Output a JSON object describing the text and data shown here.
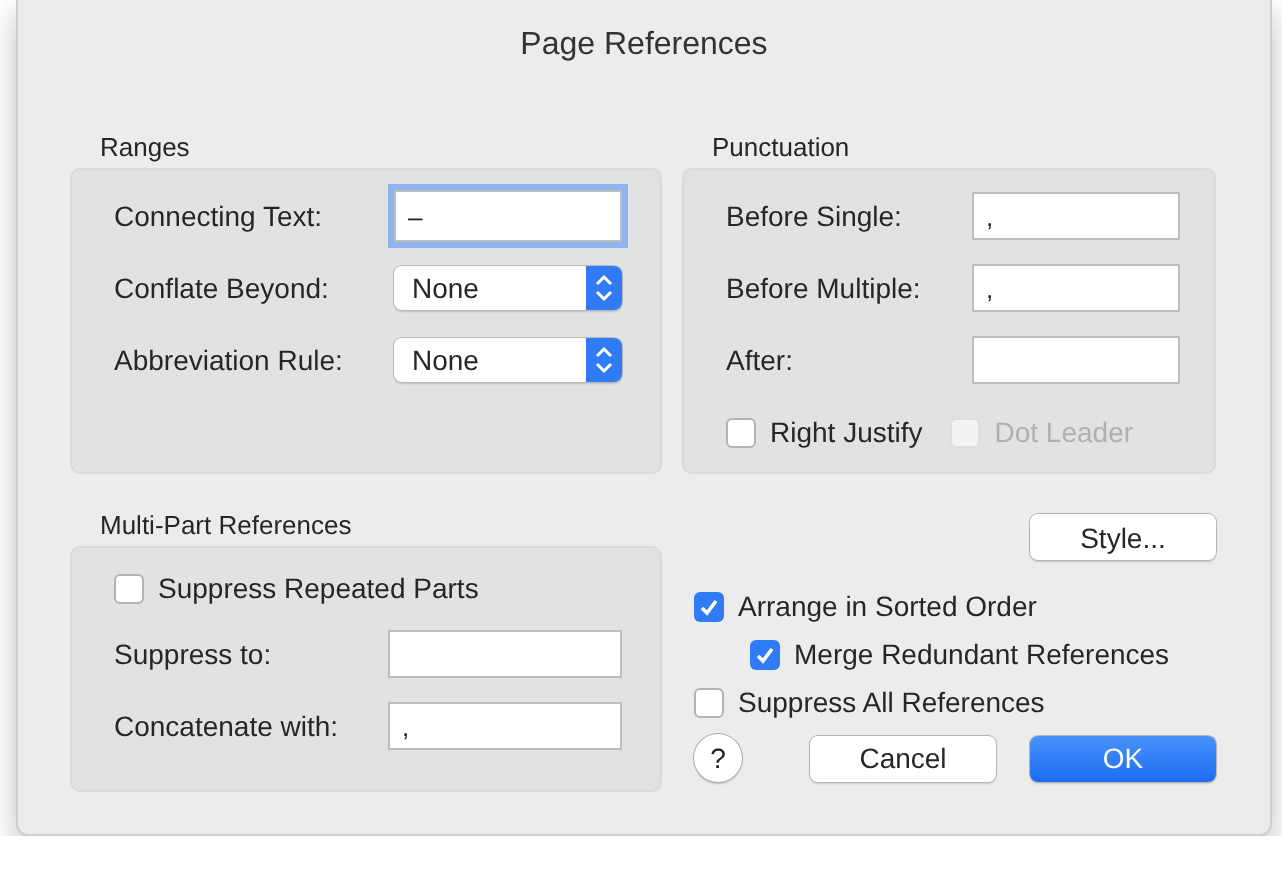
{
  "window": {
    "title": "Page References"
  },
  "ranges": {
    "title": "Ranges",
    "rows": [
      {
        "kind": "field",
        "label": "Connecting Text:",
        "value": "–",
        "focused": true
      },
      {
        "kind": "popup",
        "label": "Conflate Beyond:",
        "value": "None"
      },
      {
        "kind": "popup",
        "label": "Abbreviation Rule:",
        "value": "None"
      }
    ]
  },
  "punctuation": {
    "title": "Punctuation",
    "rows": [
      {
        "label": "Before Single:",
        "value": ","
      },
      {
        "label": "Before Multiple:",
        "value": ","
      },
      {
        "label": "After:"
      }
    ],
    "checkboxes": [
      {
        "label": "Right Justify",
        "checked": false,
        "disabled": false
      },
      {
        "label": "Dot Leader",
        "checked": false,
        "disabled": true
      }
    ]
  },
  "multipart": {
    "title": "Multi-Part References",
    "checkbox": {
      "label": "Suppress Repeated Parts",
      "checked": false
    },
    "rows": [
      {
        "label": "Suppress to:"
      },
      {
        "label": "Concatenate with:",
        "value": ","
      }
    ]
  },
  "style_button": "Style...",
  "options": [
    {
      "label": "Arrange in Sorted Order",
      "checked": true,
      "children": [
        {
          "label": "Merge Redundant References",
          "checked": true
        }
      ]
    },
    {
      "label": "Suppress All References",
      "checked": false
    }
  ],
  "help": "?",
  "buttons": [
    {
      "label": "Cancel",
      "kind": "secondary"
    },
    {
      "label": "OK",
      "kind": "default"
    }
  ]
}
